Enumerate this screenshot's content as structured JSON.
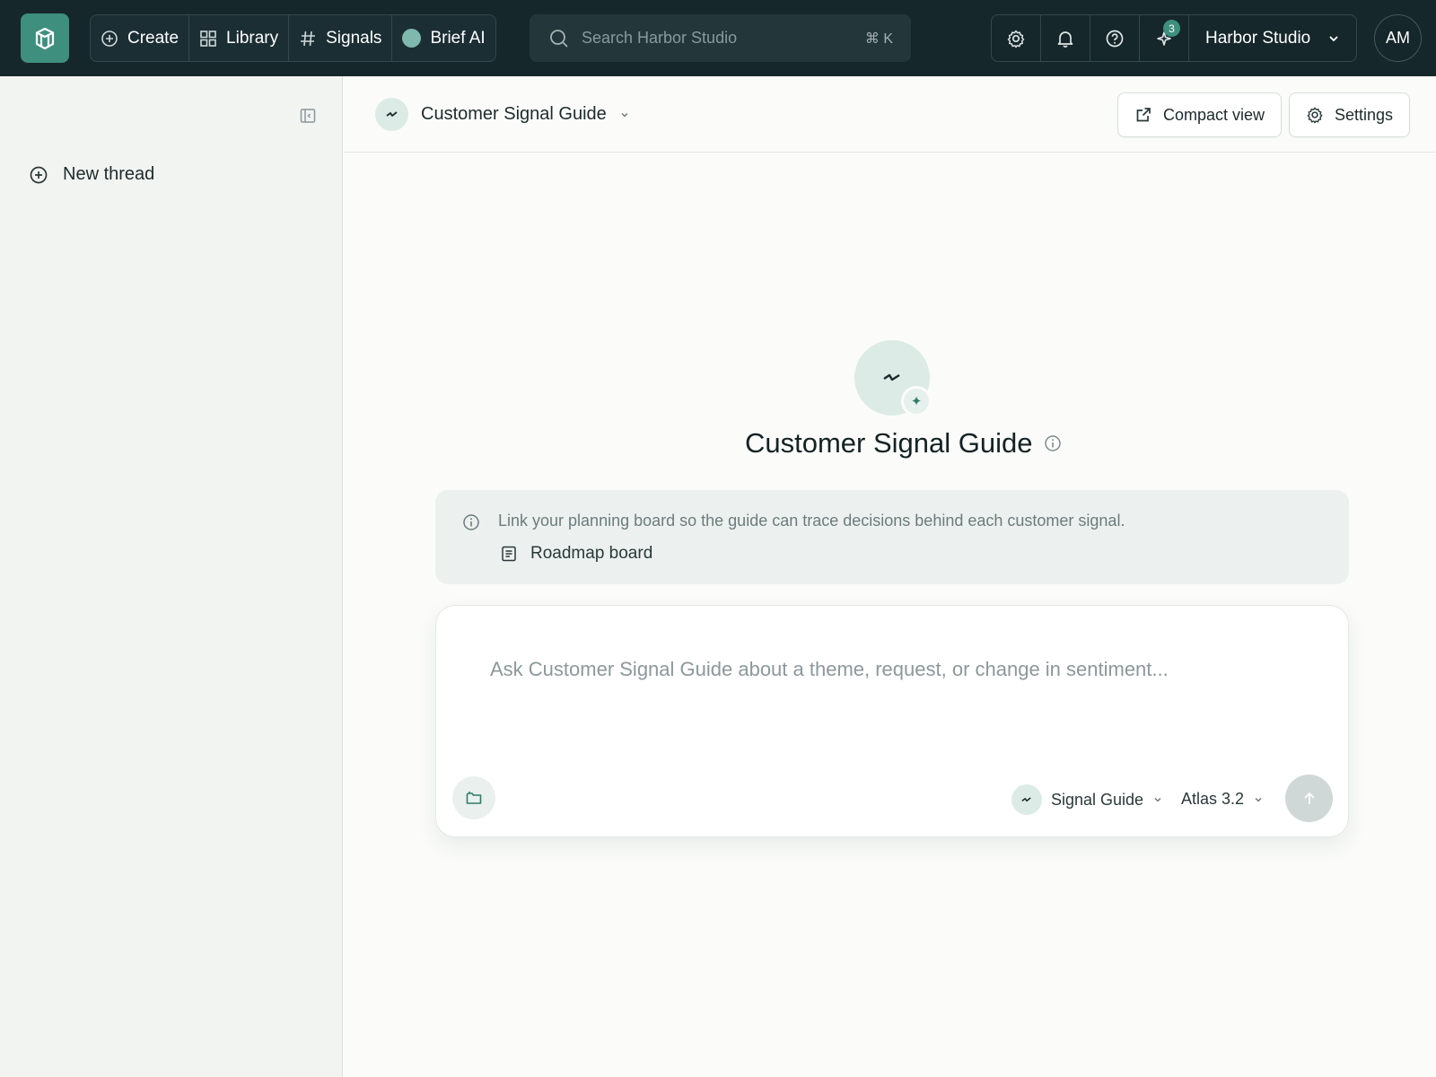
{
  "nav": {
    "create": "Create",
    "library": "Library",
    "signals": "Signals",
    "brief_ai": "Brief AI"
  },
  "search": {
    "placeholder": "Search Harbor Studio",
    "shortcut": "⌘ K"
  },
  "tools": {
    "notification_count": "3",
    "workspace": "Harbor Studio",
    "user_initials": "AM"
  },
  "sidebar": {
    "new_thread": "New thread"
  },
  "header": {
    "guide_name": "Customer Signal Guide",
    "compact_view": "Compact view",
    "settings": "Settings"
  },
  "hero": {
    "title": "Customer Signal Guide"
  },
  "notice": {
    "message": "Link your planning board so the guide can trace decisions behind each customer signal.",
    "board_label": "Roadmap board"
  },
  "composer": {
    "placeholder": "Ask Customer Signal Guide about a theme, request, or change in sentiment...",
    "agent": "Signal Guide",
    "model": "Atlas 3.2"
  },
  "colors": {
    "topbar": "#16272b",
    "accent": "#3e8f7d",
    "sidebar": "#f2f4f2",
    "notice_bg": "#ecf1ef"
  }
}
